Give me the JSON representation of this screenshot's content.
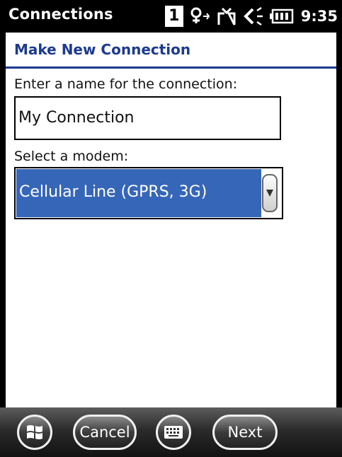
{
  "status_bar": {
    "title": "Connections",
    "sim_slot": "1",
    "time": "9:35",
    "icons": [
      "sim-slot-icon",
      "data-connection-icon",
      "missed-call-icon",
      "volume-icon",
      "battery-icon"
    ]
  },
  "header": {
    "title": "Make New Connection"
  },
  "form": {
    "name_label": "Enter a name for the connection:",
    "name_value": "My Connection",
    "modem_label": "Select a modem:",
    "modem_value": "Cellular Line (GPRS, 3G)"
  },
  "bottom_bar": {
    "start_icon": "windows-start-icon",
    "cancel_label": "Cancel",
    "keyboard_icon": "keyboard-icon",
    "next_label": "Next"
  },
  "colors": {
    "header_blue": "#1c3a8f",
    "selection_blue": "#3666b8"
  }
}
